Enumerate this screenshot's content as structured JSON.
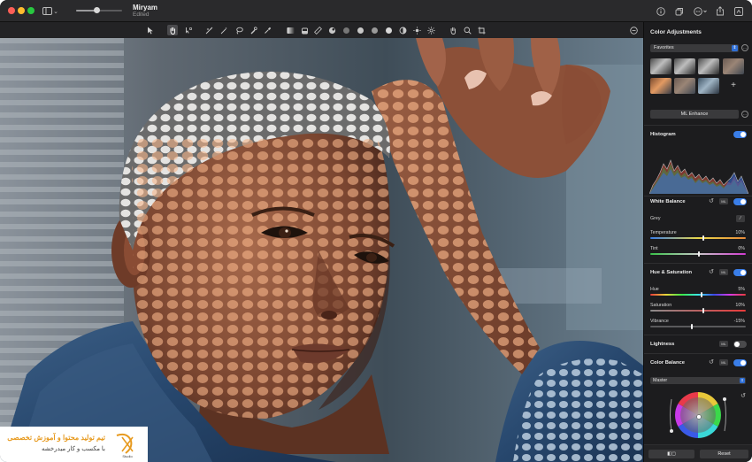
{
  "window": {
    "title": "Miryam",
    "subtitle": "Edited"
  },
  "titlebar": {
    "icons": [
      "sidebar-icon",
      "chevron-down-icon",
      "zoom-slider",
      "info-icon",
      "share-icon",
      "more-icon",
      "export-icon",
      "duplicate-icon"
    ]
  },
  "zoom": {
    "level": 0.44
  },
  "toolbar": {
    "tools": [
      "select-arrow-icon",
      "pan-hand-icon",
      "quick-select-icon",
      "paint-mask-icon",
      "magic-wand-icon",
      "lasso-icon",
      "retouch-icon",
      "eyedropper-icon",
      "gradient-icon",
      "vignette-icon",
      "ruler-icon",
      "bucket-icon",
      "clone-icon",
      "blur-icon",
      "tone-icon",
      "color-icon",
      "dodge-icon",
      "burn-icon",
      "contrast-icon",
      "brightness-icon",
      "sun-icon",
      "hand-icon",
      "zoom-icon",
      "crop-icon"
    ],
    "active_tool": "pan-hand-icon"
  },
  "sidebar": {
    "title": "Color Adjustments",
    "preset_group": "Favorites",
    "ml_enhance": "ML Enhance",
    "histogram": {
      "label": "Histogram",
      "enabled": true
    },
    "white_balance": {
      "label": "White Balance",
      "ml": "ML",
      "enabled": true,
      "grey_label": "Grey",
      "params": [
        {
          "label": "Temperature",
          "value": "10%",
          "level": 0.55
        },
        {
          "label": "Tint",
          "value": "0%",
          "level": 0.5
        }
      ]
    },
    "hue_saturation": {
      "label": "Hue & Saturation",
      "ml": "ML",
      "enabled": true,
      "params": [
        {
          "label": "Hue",
          "value": "5%",
          "level": 0.53
        },
        {
          "label": "Saturation",
          "value": "10%",
          "level": 0.55
        },
        {
          "label": "Vibrance",
          "value": "-15%",
          "level": 0.43
        }
      ]
    },
    "lightness": {
      "label": "Lightness",
      "ml": "ML",
      "enabled": false
    },
    "color_balance": {
      "label": "Color Balance",
      "ml": "ML",
      "enabled": true,
      "mode": "Master"
    },
    "footer": {
      "compare": "◧◻",
      "reset": "Reset"
    }
  },
  "watermark": {
    "line1": "تیم تولید محتوا و آموزش تخصصی",
    "line2": "با مکسب و کار میدرخشه",
    "logo_text": "Xpert Studio"
  },
  "colors": {
    "accent": "#3a7ee8",
    "titlebar": "#2a2a2c",
    "sidebar": "#1c1c1e",
    "watermark_orange": "#e79a1f"
  }
}
